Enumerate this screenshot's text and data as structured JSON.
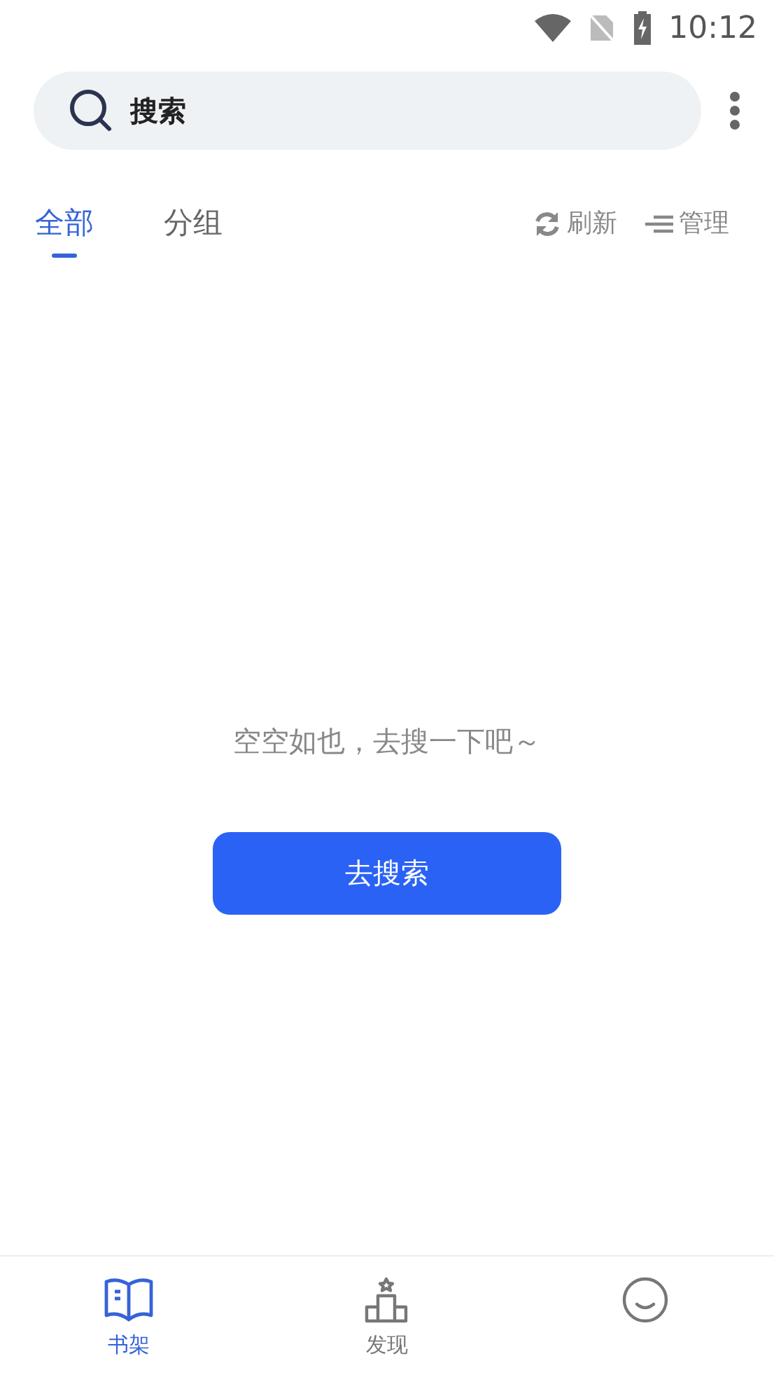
{
  "status_bar": {
    "time": "10:12"
  },
  "search": {
    "placeholder": "搜索"
  },
  "tabs": [
    {
      "label": "全部",
      "selected": true
    },
    {
      "label": "分组",
      "selected": false
    }
  ],
  "actions": [
    {
      "kind": "refresh",
      "label": "刷新"
    },
    {
      "kind": "manage",
      "label": "管理"
    }
  ],
  "empty": {
    "message": "空空如也，去搜一下吧～",
    "button": "去搜索"
  },
  "bottom_nav": [
    {
      "kind": "book",
      "label": "书架",
      "selected": true
    },
    {
      "kind": "podium",
      "label": "发现",
      "selected": false
    },
    {
      "kind": "face",
      "selected": false
    }
  ]
}
